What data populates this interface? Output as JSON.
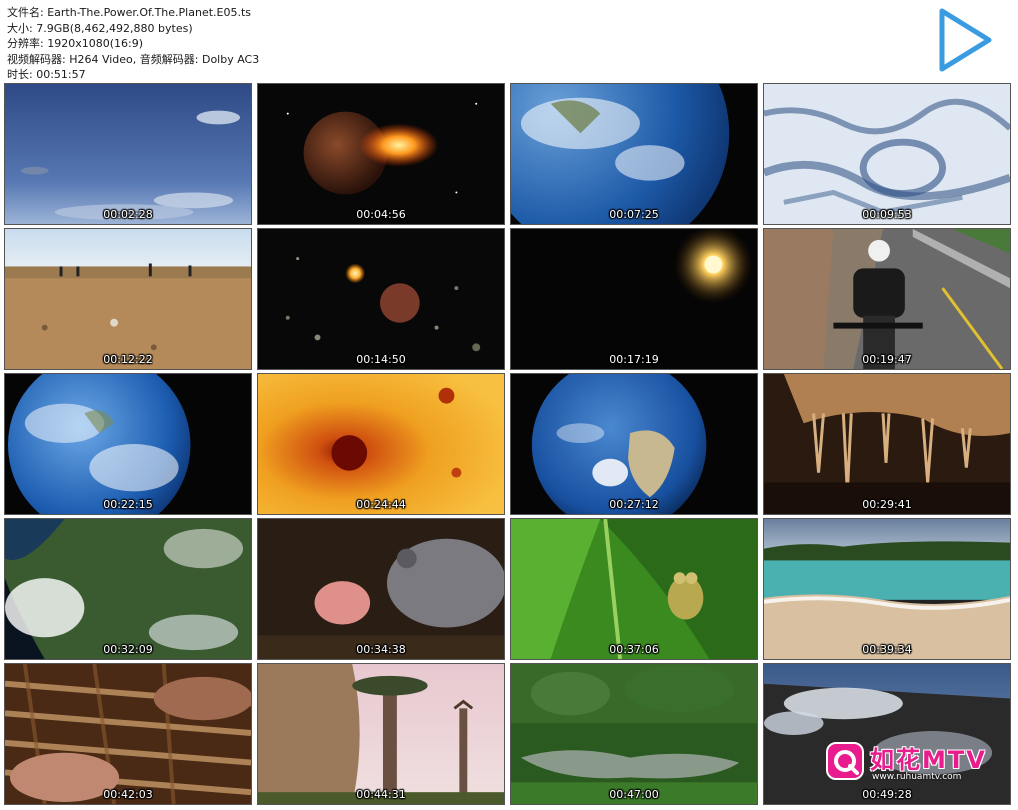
{
  "info": {
    "lines": [
      "文件名: Earth-The.Power.Of.The.Planet.E05.ts",
      "大小: 7.9GB(8,462,492,880 bytes)",
      "分辨率: 1920x1080(16:9)",
      "视频解码器: H264 Video, 音频解码器: Dolby AC3",
      "时长: 00:51:57"
    ]
  },
  "play_icon": "play-triangle-icon",
  "thumbnails": [
    {
      "time": "00:02:28",
      "scene": "sky"
    },
    {
      "time": "00:04:56",
      "scene": "impact"
    },
    {
      "time": "00:07:25",
      "scene": "earth-side"
    },
    {
      "time": "00:09:53",
      "scene": "ice"
    },
    {
      "time": "00:12:22",
      "scene": "desert"
    },
    {
      "time": "00:14:50",
      "scene": "asteroids"
    },
    {
      "time": "00:17:19",
      "scene": "sun-space"
    },
    {
      "time": "00:19:47",
      "scene": "motorbike"
    },
    {
      "time": "00:22:15",
      "scene": "earth-left"
    },
    {
      "time": "00:24:44",
      "scene": "sun-surface"
    },
    {
      "time": "00:27:12",
      "scene": "earth-africa"
    },
    {
      "time": "00:29:41",
      "scene": "cave"
    },
    {
      "time": "00:32:09",
      "scene": "satellite"
    },
    {
      "time": "00:34:38",
      "scene": "animal"
    },
    {
      "time": "00:37:06",
      "scene": "frog"
    },
    {
      "time": "00:39:34",
      "scene": "beach"
    },
    {
      "time": "00:42:03",
      "scene": "bark"
    },
    {
      "time": "00:44:31",
      "scene": "baobab"
    },
    {
      "time": "00:47:00",
      "scene": "lake"
    },
    {
      "time": "00:49:28",
      "scene": "smoke"
    }
  ],
  "watermark": {
    "logo_icon": "rh-logo-icon",
    "name": "如花MTV",
    "url": "www.ruhuamtv.com",
    "color": "#e81c8c"
  }
}
